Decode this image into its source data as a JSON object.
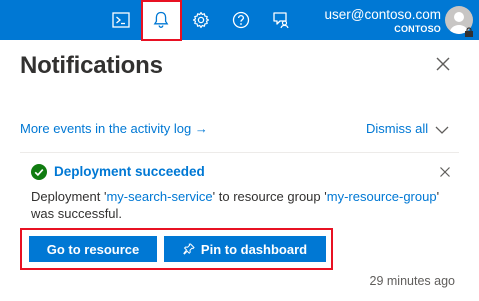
{
  "topbar": {
    "icons": [
      {
        "name": "cloud-shell-icon"
      },
      {
        "name": "notifications-bell-icon",
        "active": true
      },
      {
        "name": "settings-gear-icon"
      },
      {
        "name": "help-question-icon"
      },
      {
        "name": "feedback-icon"
      }
    ],
    "user_email": "user@contoso.com",
    "tenant": "CONTOSO"
  },
  "panel": {
    "title": "Notifications",
    "activity_link": "More events in the activity log",
    "activity_arrow": "→",
    "dismiss_all": "Dismiss all"
  },
  "notification": {
    "status": "success",
    "title": "Deployment succeeded",
    "body_prefix": "Deployment '",
    "resource_name": "my-search-service",
    "body_middle": "' to resource group '",
    "resource_group": "my-resource-group",
    "body_suffix": "' was successful.",
    "go_to_resource_label": "Go to resource",
    "pin_label": "Pin to dashboard",
    "timestamp": "29 minutes ago"
  },
  "colors": {
    "accent": "#0078d4",
    "success": "#107c10",
    "highlight": "#e81123"
  }
}
